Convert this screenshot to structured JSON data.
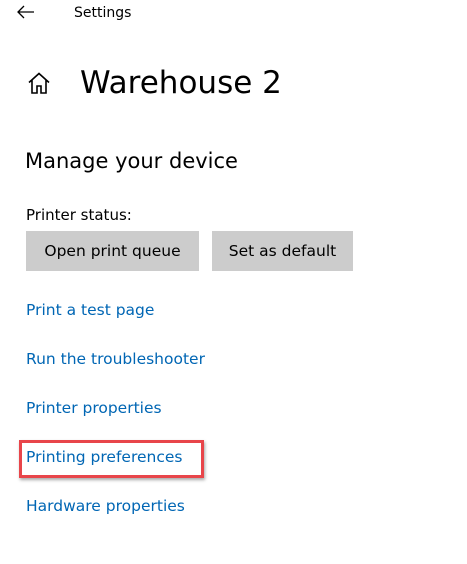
{
  "window": {
    "app_title": "Settings",
    "back_icon": "back-arrow-icon"
  },
  "header": {
    "home_icon": "home-icon",
    "title": "Warehouse 2"
  },
  "section": {
    "title": "Manage your device",
    "status_label": "Printer status:"
  },
  "buttons": {
    "open_queue": "Open print queue",
    "set_default": "Set as default"
  },
  "links": [
    {
      "label": "Print a test page"
    },
    {
      "label": "Run the troubleshooter"
    },
    {
      "label": "Printer properties"
    },
    {
      "label": "Printing preferences",
      "highlighted": true
    },
    {
      "label": "Hardware properties"
    }
  ],
  "colors": {
    "link": "#0066b4",
    "button_bg": "#cccccc",
    "highlight": "#e8454a"
  }
}
